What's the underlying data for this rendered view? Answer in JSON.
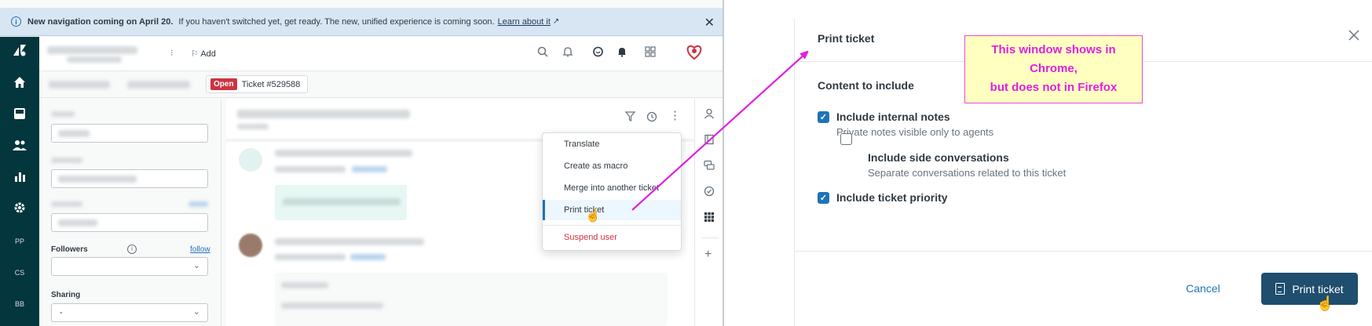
{
  "banner": {
    "title": "New navigation coming on April 20.",
    "message": "If you haven't switched yet, get ready. The new, unified experience is coming soon.",
    "link": "Learn about it",
    "close": "✕"
  },
  "nav": {
    "items": [
      {
        "icon": "zendesk-logo-icon"
      },
      {
        "icon": "home-icon"
      },
      {
        "icon": "views-icon"
      },
      {
        "icon": "customers-icon"
      },
      {
        "icon": "reporting-icon"
      },
      {
        "icon": "admin-gear-icon"
      }
    ],
    "text_items": [
      "PP",
      "CS",
      "BB"
    ]
  },
  "topbar": {
    "add_label": "Add"
  },
  "ticket_tab": {
    "status": "Open",
    "title": "Ticket #529588"
  },
  "properties": {
    "followers_label": "Followers",
    "follow_link": "follow",
    "sharing_label": "Sharing",
    "sharing_value": "-"
  },
  "menu": {
    "items": [
      {
        "label": "Translate"
      },
      {
        "label": "Create as macro"
      },
      {
        "label": "Merge into another ticket"
      },
      {
        "label": "Print ticket",
        "selected": true
      },
      {
        "label": "Suspend user",
        "danger": true
      }
    ]
  },
  "dialog": {
    "title": "Print ticket",
    "section_title": "Content to include",
    "options": [
      {
        "label": "Include internal notes",
        "hint": "Private notes visible only to agents",
        "checked": true
      },
      {
        "label": "Include side conversations",
        "hint": "Separate conversations related to this ticket",
        "checked": false
      },
      {
        "label": "Include ticket priority",
        "checked": true
      }
    ],
    "cancel_label": "Cancel",
    "print_label": "Print ticket"
  },
  "annotation": {
    "lines": [
      "This window shows in",
      "Chrome,",
      "but does not in Firefox"
    ],
    "color": "#e020e0"
  },
  "colors": {
    "nav_bg": "#03363d",
    "primary": "#1f73b7",
    "primary_button": "#1f4e6e",
    "danger": "#cc3340",
    "banner_bg": "#d8e6f3"
  }
}
